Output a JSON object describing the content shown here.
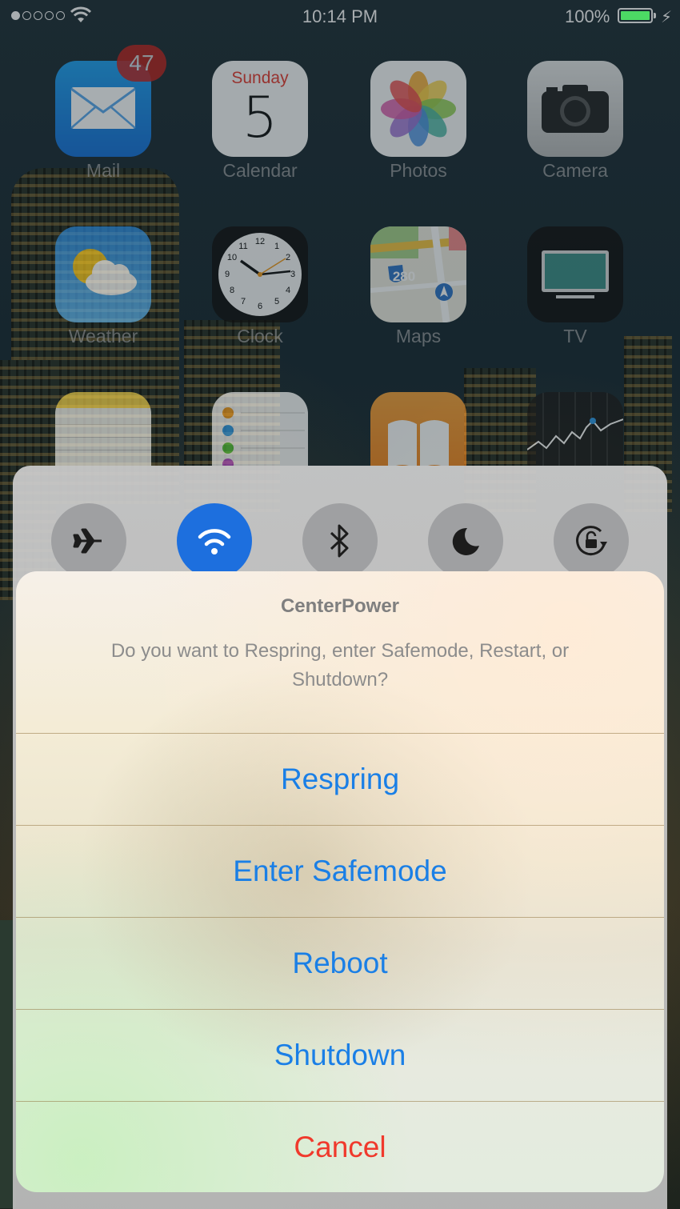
{
  "status_bar": {
    "time": "10:14 PM",
    "battery": "100%"
  },
  "home": {
    "apps": [
      {
        "name": "Mail",
        "badge": "47",
        "icon": "mail-icon"
      },
      {
        "name": "Calendar",
        "day": "Sunday",
        "date": "5",
        "icon": "calendar-icon"
      },
      {
        "name": "Photos",
        "icon": "photos-icon"
      },
      {
        "name": "Camera",
        "icon": "camera-icon"
      },
      {
        "name": "Weather",
        "icon": "weather-icon"
      },
      {
        "name": "Clock",
        "icon": "clock-icon"
      },
      {
        "name": "Maps",
        "route": "280",
        "icon": "maps-icon"
      },
      {
        "name": "TV",
        "icon": "tv-icon"
      }
    ],
    "clock_numbers": [
      "12",
      "1",
      "2",
      "3",
      "4",
      "5",
      "6",
      "7",
      "8",
      "9",
      "10",
      "11"
    ]
  },
  "control_center": {
    "toggles": [
      {
        "icon": "airplane-icon",
        "active": false
      },
      {
        "icon": "wifi-icon",
        "active": true
      },
      {
        "icon": "bluetooth-icon",
        "active": false
      },
      {
        "icon": "moon-icon",
        "active": false
      },
      {
        "icon": "rotation-lock-icon",
        "active": false
      }
    ]
  },
  "alert": {
    "title": "CenterPower",
    "message": "Do you want to Respring, enter Safemode, Restart, or Shutdown?",
    "buttons": [
      {
        "label": "Respring"
      },
      {
        "label": "Enter Safemode"
      },
      {
        "label": "Reboot"
      },
      {
        "label": "Shutdown"
      },
      {
        "label": "Cancel"
      }
    ]
  },
  "colors": {
    "accent": "#1a7fe6",
    "destructive": "#f0392c",
    "badge": "#c9221c",
    "wifi_active": "#1d6fde"
  }
}
